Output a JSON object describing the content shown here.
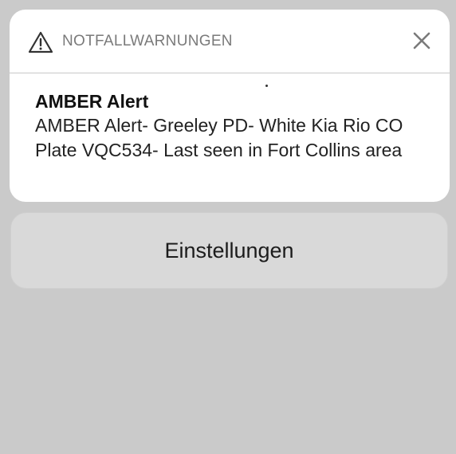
{
  "notification": {
    "header": {
      "icon": "warning-triangle-icon",
      "title": "NOTFALLWARNUNGEN",
      "close_icon": "close-icon"
    },
    "alert_title": "AMBER Alert",
    "alert_message": "AMBER Alert- Greeley PD- White Kia Rio CO Plate VQC534- Last seen in Fort Collins area"
  },
  "actions": {
    "settings_label": "Einstellungen"
  },
  "colors": {
    "background": "#cacaca",
    "card": "#ffffff",
    "button": "#d9d9d9",
    "header_text": "#7a7a7a"
  }
}
